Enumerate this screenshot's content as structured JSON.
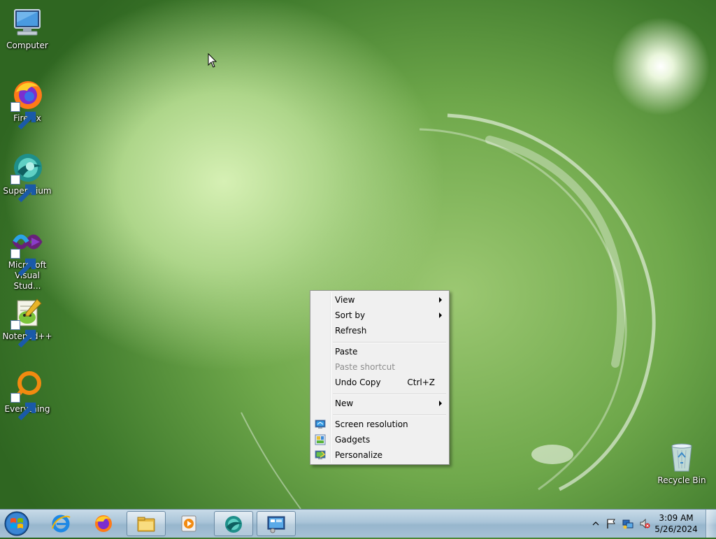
{
  "desktop": {
    "icons": [
      {
        "label": "Computer",
        "icon": "computer-icon"
      },
      {
        "label": "Firefox",
        "icon": "firefox-icon"
      },
      {
        "label": "Supermium",
        "icon": "supermium-icon"
      },
      {
        "label": "Microsoft Visual Stud...",
        "line1": "Microsoft",
        "line2": "Visual Stud...",
        "icon": "visual-studio-icon"
      },
      {
        "label": "Notepad++",
        "icon": "notepadpp-icon"
      },
      {
        "label": "Everything",
        "icon": "everything-icon"
      },
      {
        "label": "Recycle Bin",
        "icon": "recycle-bin-icon"
      }
    ]
  },
  "context_menu": {
    "items": [
      {
        "label": "View",
        "submenu": true
      },
      {
        "label": "Sort by",
        "submenu": true
      },
      {
        "label": "Refresh"
      },
      {
        "label": "Paste"
      },
      {
        "label": "Paste shortcut",
        "disabled": true
      },
      {
        "label": "Undo Copy",
        "shortcut": "Ctrl+Z"
      },
      {
        "label": "New",
        "submenu": true
      },
      {
        "label": "Screen resolution",
        "icon": "screen-resolution-icon"
      },
      {
        "label": "Gadgets",
        "icon": "gadgets-icon"
      },
      {
        "label": "Personalize",
        "icon": "personalize-icon"
      }
    ]
  },
  "taskbar": {
    "pinned": [
      "internet-explorer-icon",
      "firefox-icon",
      "file-explorer-icon",
      "media-player-icon",
      "supermium-icon",
      "control-panel-icon"
    ],
    "clock": {
      "time": "3:09 AM",
      "date": "5/26/2024"
    }
  },
  "colors": {
    "menu_bg": "#f0f0f0",
    "menu_disabled": "#8d8d8d",
    "taskbar": "#a9c4d8"
  }
}
